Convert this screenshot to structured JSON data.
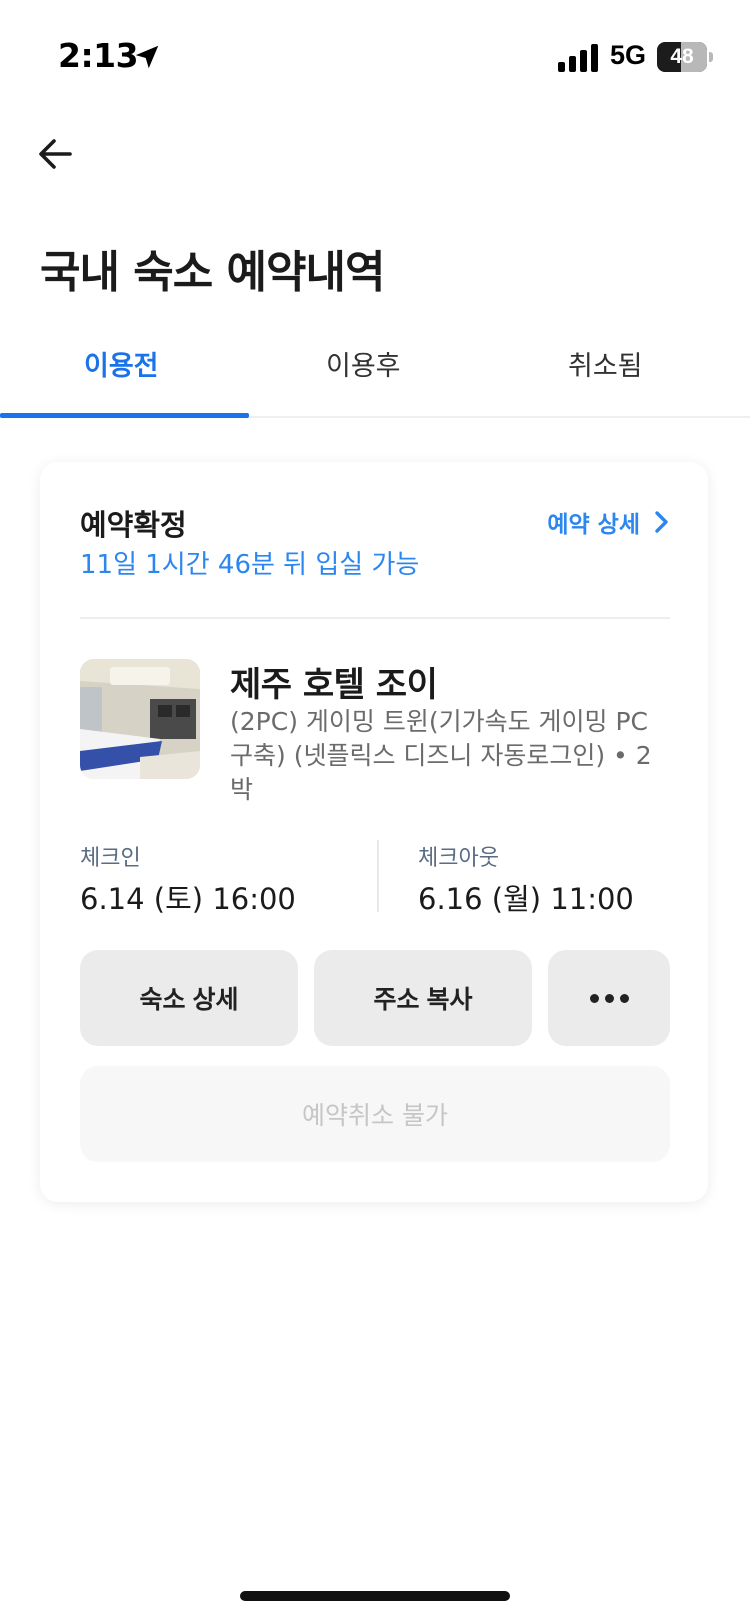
{
  "status_bar": {
    "time": "2:13",
    "network": "5G",
    "battery_level": "48",
    "battery_fraction": 0.48
  },
  "header": {
    "back_icon": "arrow-left-icon",
    "title": "국내 숙소 예약내역"
  },
  "tabs": [
    {
      "label": "이용전",
      "active": true
    },
    {
      "label": "이용후",
      "active": false
    },
    {
      "label": "취소됨",
      "active": false
    }
  ],
  "colors": {
    "accent": "#1a73e8",
    "link": "#2b87ef",
    "button_bg": "#ebebeb"
  },
  "reservation": {
    "status": "예약확정",
    "remaining": "11일 1시간 46분 뒤 입실 가능",
    "detail_link": "예약 상세",
    "hotel_name": "제주 호텔 조이",
    "room_desc": "(2PC) 게이밍 트윈(기가속도 게이밍 PC 구축) (넷플릭스 디즈니 자동로그인) • 2박",
    "checkin_label": "체크인",
    "checkin_value": "6.14 (토) 16:00",
    "checkout_label": "체크아웃",
    "checkout_value": "6.16 (월) 11:00",
    "buttons": {
      "hotel_detail": "숙소 상세",
      "copy_address": "주소 복사",
      "more_icon": "more-dots-icon"
    },
    "cancel_label": "예약취소 불가"
  }
}
